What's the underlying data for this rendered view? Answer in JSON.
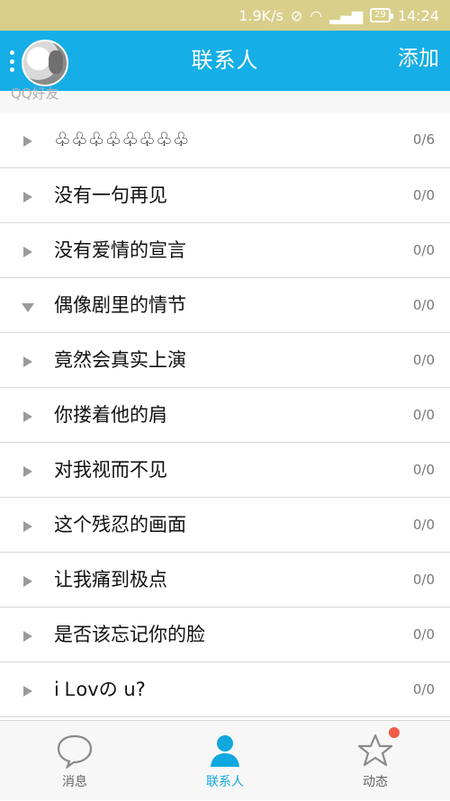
{
  "status": {
    "speed": "1.9K/s",
    "battery": "29",
    "time": "14:24"
  },
  "header": {
    "title": "联系人",
    "action": "添加"
  },
  "section": {
    "label": "QQ好友"
  },
  "groups": [
    {
      "name": "♧♧♧♧♧♧♧♧",
      "count": "0/6"
    },
    {
      "name": "没有一句再见",
      "count": "0/0"
    },
    {
      "name": "没有爱情的宣言",
      "count": "0/0"
    },
    {
      "name": "偶像剧里的情节",
      "count": "0/0"
    },
    {
      "name": "竟然会真实上演",
      "count": "0/0"
    },
    {
      "name": "你搂着他的肩",
      "count": "0/0"
    },
    {
      "name": "对我视而不见",
      "count": "0/0"
    },
    {
      "name": "这个残忍的画面",
      "count": "0/0"
    },
    {
      "name": "让我痛到极点",
      "count": "0/0"
    },
    {
      "name": "是否该忘记你的脸",
      "count": "0/0"
    },
    {
      "name": "  i  Ꮮovの  u?",
      "count": "0/0"
    }
  ],
  "nav": [
    {
      "label": "消息",
      "icon": "message-bubble-icon"
    },
    {
      "label": "联系人",
      "icon": "contact-person-icon"
    },
    {
      "label": "动态",
      "icon": "star-icon"
    }
  ],
  "colors": {
    "accent": "#15aee6",
    "status_bar": "#d9cf8b",
    "notification": "#f05b48"
  }
}
